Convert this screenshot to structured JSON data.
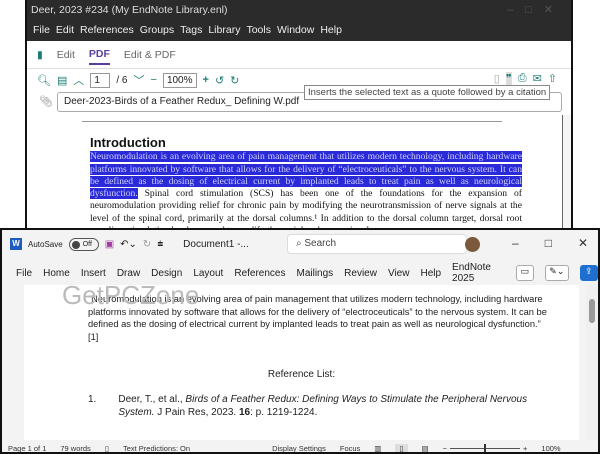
{
  "endnote": {
    "title": "Deer, 2023 #234 (My EndNote Library.enl)",
    "menu": [
      "File",
      "Edit",
      "References",
      "Groups",
      "Tags",
      "Library",
      "Tools",
      "Window",
      "Help"
    ],
    "tabs": [
      "Edit",
      "PDF",
      "Edit & PDF"
    ],
    "active_tab": "PDF",
    "page": "1",
    "page_total": "/ 6",
    "zoom": "100%",
    "tooltip": "Inserts the selected text as a quote followed by a citation",
    "file": "Deer-2023-Birds of a Feather Redux_ Defining W.pdf",
    "heading": "Introduction",
    "highlighted": "Neuromodulation is an evolving area of pain management that utilizes modern technology, including hardware platforms innovated by software that allows for the delivery of “electroceuticals” to the nervous system. It can be defined as the dosing of electrical current by implanted leads to treat pain as well as neurological dysfunction.",
    "rest": " Spinal cord stimulation (SCS) has been one of the foundations for the expansion of neuromodulation providing relief for chronic pain by modifying the neurotransmission of nerve signals at the level of the spinal cord, primarily at the dorsal columns.¹ In addition to the dorsal column target, dorsal root ganglion stimulation has been used to modify the peripheral nerve signal"
  },
  "word": {
    "autosave": "AutoSave",
    "toggle": "Off",
    "doc_name": "Document1 -...",
    "search": "Search",
    "ribbon": [
      "File",
      "Home",
      "Insert",
      "Draw",
      "Design",
      "Layout",
      "References",
      "Mailings",
      "Review",
      "View",
      "Help",
      "EndNote 2025"
    ],
    "watermark": "GetPCZone",
    "quote": "“Neuromodulation is an evolving area of pain management that utilizes modern technology, including hardware platforms innovated by software that allows for the delivery of “electroceuticals” to the nervous system. It can be defined as the dosing of electrical current by implanted leads to treat pain as well as neurological dysfunction.” [1]",
    "ref_heading": "Reference List:",
    "ref_num": "1.",
    "ref_authors": "Deer, T., et al., ",
    "ref_title": "Birds of a Feather Redux: Defining Ways to Stimulate the Peripheral Nervous System.",
    "ref_journal": " J Pain Res, 2023. ",
    "ref_vol": "16",
    "ref_pages": ": p. 1219-1224.",
    "status": {
      "page": "Page 1 of 1",
      "words": "79 words",
      "predictions": "Text Predictions: On",
      "display": "Display Settings",
      "focus": "Focus",
      "zoom": "100%"
    },
    "zoom_level_percent": 100
  }
}
